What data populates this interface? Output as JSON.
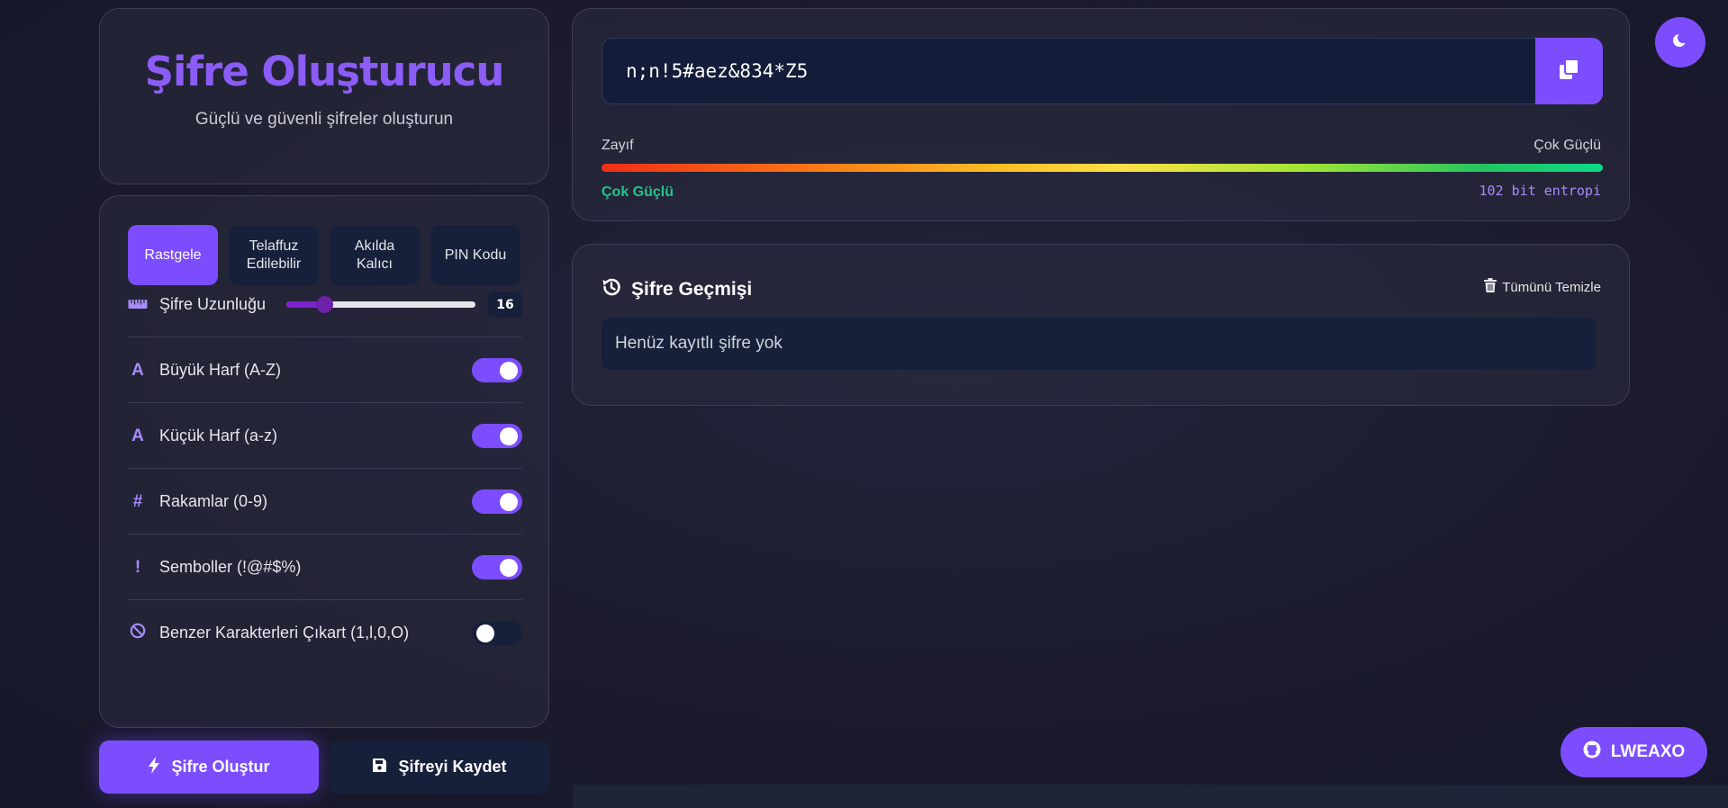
{
  "header": {
    "title": "Şifre Oluşturucu",
    "subtitle": "Güçlü ve güvenli şifreler oluşturun"
  },
  "modes": [
    {
      "label": "Rastgele",
      "active": true
    },
    {
      "label": "Telaffuz Edilebilir",
      "active": false
    },
    {
      "label": "Akılda Kalıcı",
      "active": false
    },
    {
      "label": "PIN Kodu",
      "active": false
    }
  ],
  "length": {
    "label": "Şifre Uzunluğu",
    "value": "16",
    "icon": "ruler-icon"
  },
  "options": [
    {
      "label": "Büyük Harf (A-Z)",
      "enabled": true,
      "icon": "letter-a-icon",
      "glyph": "A"
    },
    {
      "label": "Küçük Harf (a-z)",
      "enabled": true,
      "icon": "letter-a-icon",
      "glyph": "A"
    },
    {
      "label": "Rakamlar (0-9)",
      "enabled": true,
      "icon": "hashtag-icon",
      "glyph": "#"
    },
    {
      "label": "Semboller (!@#$%)",
      "enabled": true,
      "icon": "exclamation-icon",
      "glyph": "!"
    },
    {
      "label": "Benzer Karakterleri Çıkart (1,l,0,O)",
      "enabled": false,
      "icon": "ban-icon",
      "glyph": ""
    }
  ],
  "actions": {
    "generate_label": "Şifre Oluştur",
    "save_label": "Şifreyi Kaydet"
  },
  "password": {
    "value": "n;n!5#aez&834*Z5",
    "weak_label": "Zayıf",
    "strong_label": "Çok Güçlü",
    "strength": "Çok Güçlü",
    "entropy": "102 bit entropi"
  },
  "history": {
    "title": "Şifre Geçmişi",
    "clear_label": "Tümünü Temizle",
    "empty_text": "Henüz kayıtlı şifre yok"
  },
  "github": {
    "label": "LWEAXO"
  },
  "colors": {
    "accent": "#7c4dff",
    "title": "#8b5cf6",
    "success": "#22c58e",
    "background": "#1b1b2d"
  }
}
